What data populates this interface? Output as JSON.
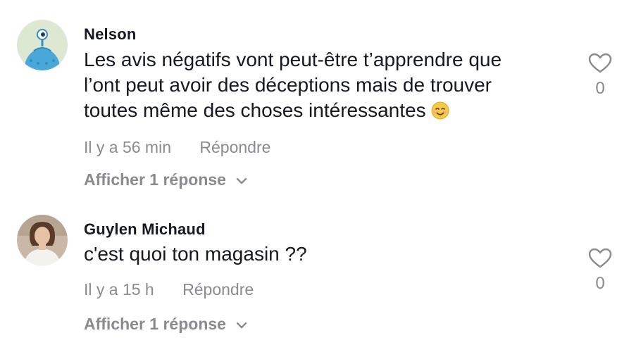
{
  "comments": [
    {
      "username": "Nelson",
      "avatar_icon": "blue-alien-icon",
      "text_lines": [
        "Les avis négatifs vont peut-être t’apprendre que",
        "l’ont peut avoir des déceptions mais de trouver",
        "toutes même des choses intéressantes"
      ],
      "emoji_icon": "smiling-face-icon",
      "time": "Il y a 56 min",
      "reply_label": "Répondre",
      "view_replies_label": "Afficher 1 réponse",
      "likes": "0"
    },
    {
      "username": "Guylen Michaud",
      "avatar_icon": "profile-photo",
      "text_lines": [
        "c'est quoi ton magasin ??"
      ],
      "time": "Il y a 15 h",
      "reply_label": "Répondre",
      "view_replies_label": "Afficher 1 réponse",
      "likes": "0"
    }
  ],
  "colors": {
    "text": "#161823",
    "muted": "#8a8b91",
    "avatar_bg": "#dde8d2",
    "alien_blue": "#4aa8d8"
  }
}
